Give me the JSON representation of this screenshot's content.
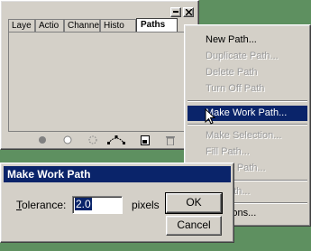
{
  "palette": {
    "tabs": [
      "Laye",
      "Actio",
      "Channe",
      "Histo",
      "Paths"
    ],
    "active_tab": "Paths",
    "toolbar_icons": [
      "fill-path-icon",
      "stroke-path-icon",
      "load-selection-icon",
      "make-work-path-icon",
      "new-path-icon",
      "trash-icon"
    ]
  },
  "menu": {
    "items": [
      {
        "label": "New Path...",
        "enabled": true
      },
      {
        "label": "Duplicate Path...",
        "enabled": false
      },
      {
        "label": "Delete Path",
        "enabled": false
      },
      {
        "label": "Turn Off Path",
        "enabled": false
      },
      {
        "label": "Make Work Path...",
        "enabled": true,
        "highlighted": true
      },
      {
        "label": "Make Selection...",
        "enabled": false
      },
      {
        "label": "Fill Path...",
        "enabled": false
      },
      {
        "label": "Stroke Path...",
        "enabled": false
      },
      {
        "label": "ing Path...",
        "enabled": false
      },
      {
        "label": "e Options...",
        "enabled": true
      }
    ]
  },
  "dialog": {
    "title": "Make Work Path",
    "tolerance_label_first": "T",
    "tolerance_label_rest": "olerance:",
    "tolerance_value": "2.0",
    "units": "pixels",
    "ok_label": "OK",
    "cancel_label": "Cancel"
  },
  "colors": {
    "desktop": "#5e9060",
    "face": "#d4d0c8",
    "highlight": "#0a246a"
  }
}
